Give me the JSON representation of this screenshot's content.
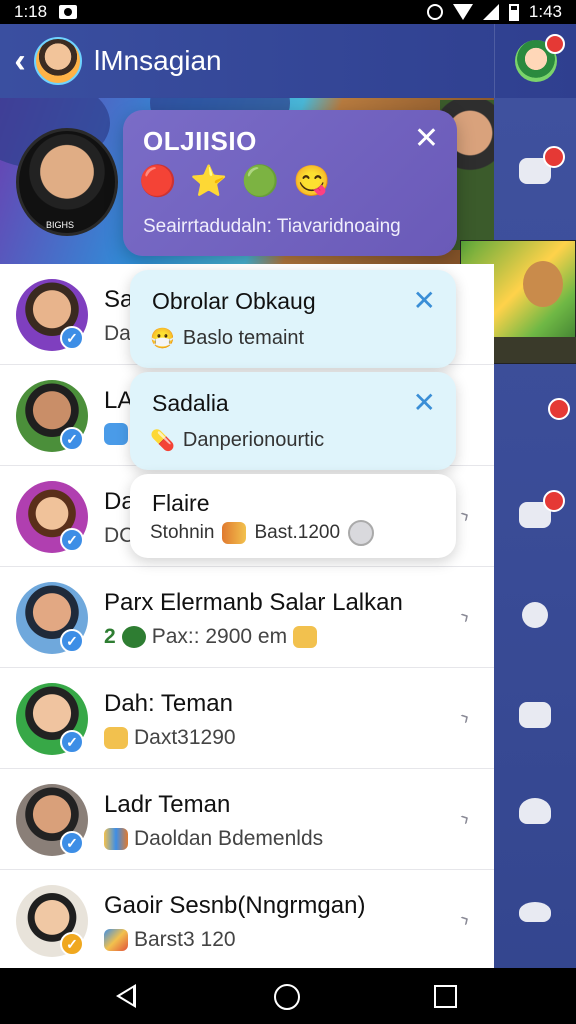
{
  "status_bar": {
    "time": "1:18",
    "time_right": "1:43"
  },
  "app_bar": {
    "title": "lMnsagian"
  },
  "promo": {
    "title": "OLJIISIO",
    "subtitle": "Seairrtadudaln: Tiavaridnoaing",
    "emojis": [
      "🔴",
      "⭐",
      "🟢",
      "😋"
    ]
  },
  "big_avatar_label": "BIGHS",
  "overlays": [
    {
      "title": "Obrolar Obkaug",
      "sub": "Baslo temaint",
      "emoji": "😷"
    },
    {
      "title": "Sadalia",
      "sub": "Danperionourtic",
      "emoji": "💊"
    },
    {
      "title": "Flaire",
      "sub_left": "Stohnin",
      "sub_right": "Bast.1200"
    }
  ],
  "chats": [
    {
      "name": "Sa",
      "sub": "Da"
    },
    {
      "name": "LA",
      "sub": ""
    },
    {
      "name": "Da",
      "sub": "DC"
    },
    {
      "name": "Parx Elermanb Salar Lalkan",
      "sub_prefix": "2",
      "sub": "Pax:: 2900 em"
    },
    {
      "name": "Dah: Teman",
      "sub": "Daxt31290"
    },
    {
      "name": "Ladr Teman",
      "sub": "Daoldan Bdemenlds"
    },
    {
      "name": "Gaoir Sesnb(Nngrmgan)",
      "sub": "Barst3 120"
    }
  ],
  "colors": {
    "app_bar": "#3a4fa0",
    "rail": "#3f519e",
    "badge_red": "#e53935",
    "verified_blue": "#3d8ee6",
    "overlay_bg": "#dff4fb",
    "close_blue": "#3a8ed6"
  },
  "icons": {
    "back": "chevron-left-icon",
    "rail": [
      "chat-icon",
      "d-icon",
      "chat-icon",
      "people-icon",
      "speech-icon",
      "user-icon",
      "user-icon"
    ],
    "nav": [
      "nav-back-icon",
      "nav-home-icon",
      "nav-recents-icon"
    ]
  }
}
